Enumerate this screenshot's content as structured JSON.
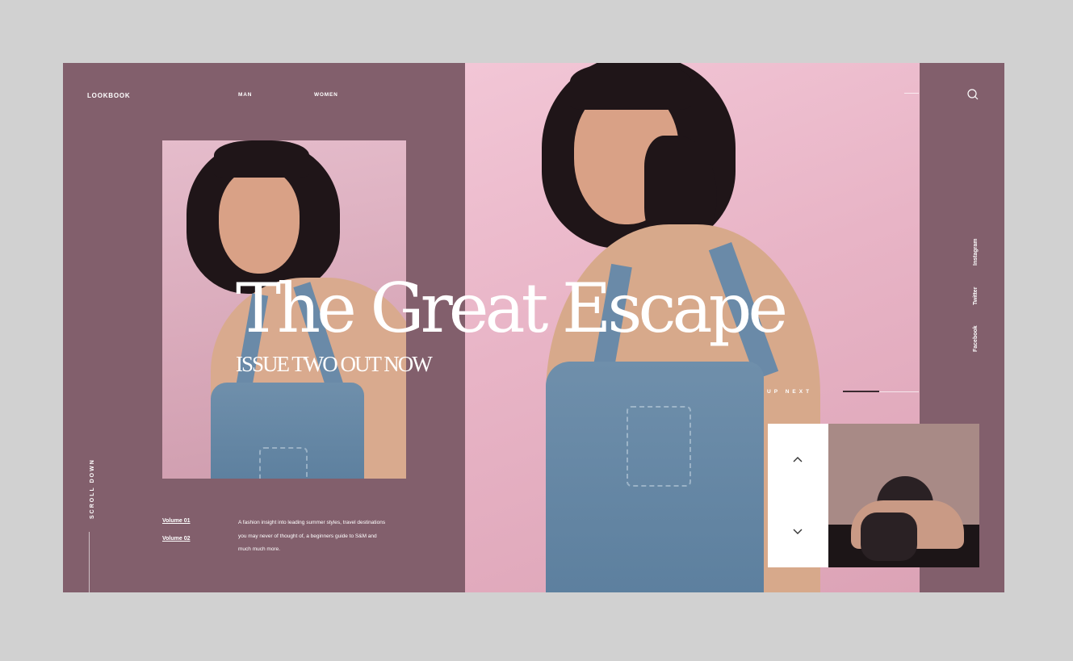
{
  "header": {
    "brand": "LOOKBOOK",
    "nav": [
      "MAN",
      "WOMEN"
    ]
  },
  "hero": {
    "title": "The Great Escape",
    "subtitle": "ISSUE TWO OUT NOW"
  },
  "sidebar_left": {
    "scroll_label": "SCROLL DOWN"
  },
  "volumes": [
    "Volume 01",
    "Volume 02"
  ],
  "description": "A fashion insight into leading summer styles, travel destinations you may never of thought of, a beginners guide to S&M and much much more.",
  "social": [
    "Facebook",
    "Twitter",
    "Instagram"
  ],
  "up_next": {
    "label": "UP NEXT"
  },
  "icons": {
    "search": "search-icon",
    "up": "chevron-up-icon",
    "down": "chevron-down-icon"
  },
  "colors": {
    "background": "#d1d1d1",
    "panel": "#825f6c",
    "hero_pink": "#e8b4c6",
    "white": "#ffffff"
  }
}
